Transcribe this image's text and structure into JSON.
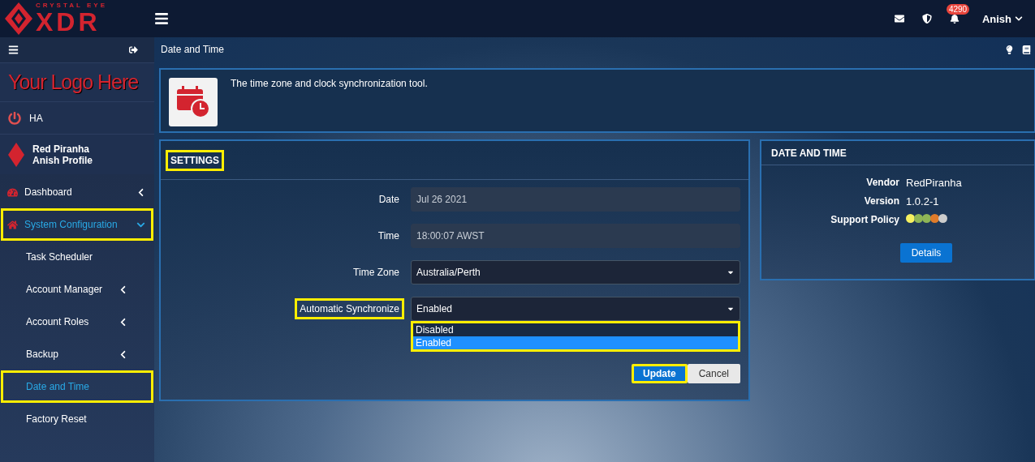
{
  "brand": {
    "tagline": "CRYSTAL EYE",
    "name": "XDR"
  },
  "topbar": {
    "notifications": "4290",
    "user": "Anish"
  },
  "sidebar": {
    "logo_text": "Your Logo Here",
    "ha": "HA",
    "profile": {
      "org": "Red Piranha",
      "name": "Anish Profile"
    },
    "items": [
      {
        "label": "Dashboard",
        "kind": "gauge",
        "selected": false,
        "expanded": false,
        "highlighted": false
      },
      {
        "label": "System Configuration",
        "kind": "home",
        "selected": true,
        "expanded": true,
        "highlighted": true,
        "children": [
          {
            "label": "Task Scheduler",
            "has_sub": false,
            "selected": false,
            "highlighted": false
          },
          {
            "label": "Account Manager",
            "has_sub": true,
            "selected": false,
            "highlighted": false
          },
          {
            "label": "Account Roles",
            "has_sub": true,
            "selected": false,
            "highlighted": false
          },
          {
            "label": "Backup",
            "has_sub": true,
            "selected": false,
            "highlighted": false
          },
          {
            "label": "Date and Time",
            "has_sub": false,
            "selected": true,
            "highlighted": true
          },
          {
            "label": "Factory Reset",
            "has_sub": false,
            "selected": false,
            "highlighted": false
          }
        ]
      }
    ]
  },
  "breadcrumb": "Date and Time",
  "intro": "The time zone and clock synchronization tool.",
  "settings": {
    "title": "SETTINGS",
    "title_highlighted": true,
    "fields": [
      {
        "label": "Date",
        "kind": "readonly",
        "value": "Jul 26 2021",
        "highlighted": false
      },
      {
        "label": "Time",
        "kind": "readonly",
        "value": "18:00:07 AWST",
        "highlighted": false
      },
      {
        "label": "Time Zone",
        "kind": "select",
        "value": "Australia/Perth",
        "highlighted": false
      },
      {
        "label": "Automatic Synchronize",
        "kind": "select",
        "value": "Enabled",
        "highlighted": true,
        "open": true,
        "options": [
          {
            "label": "Disabled",
            "selected": false
          },
          {
            "label": "Enabled",
            "selected": true
          }
        ]
      }
    ],
    "buttons": [
      {
        "label": "Update",
        "kind": "primary",
        "highlighted": true
      },
      {
        "label": "Cancel",
        "kind": "default",
        "highlighted": false
      }
    ]
  },
  "info": {
    "title": "DATE AND TIME",
    "rows": [
      {
        "label": "Vendor",
        "value": "RedPiranha"
      },
      {
        "label": "Version",
        "value": "1.0.2-1"
      }
    ],
    "support_label": "Support Policy",
    "support_dots": [
      {
        "color": "#f5f060"
      },
      {
        "color": "#8fb556"
      },
      {
        "color": "#8fb556"
      },
      {
        "color": "#e07b2a"
      },
      {
        "color": "#cccccc"
      }
    ],
    "button": "Details"
  }
}
